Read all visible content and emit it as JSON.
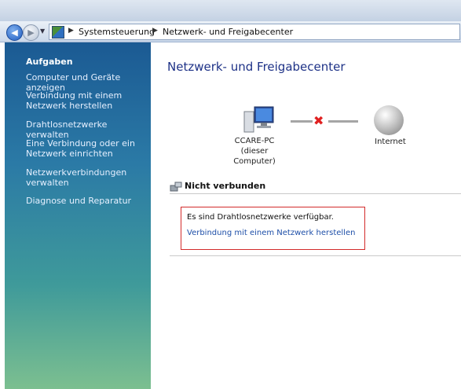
{
  "address_bar": {
    "crumbs": [
      "Systemsteuerung",
      "Netzwerk- und Freigabecenter"
    ]
  },
  "sidebar": {
    "heading": "Aufgaben",
    "items": [
      {
        "label": "Computer und Geräte anzeigen"
      },
      {
        "label": "Verbindung mit einem Netzwerk herstellen"
      },
      {
        "label": "Drahtlosnetzwerke verwalten"
      },
      {
        "label": "Eine Verbindung oder ein Netzwerk einrichten"
      },
      {
        "label": "Netzwerkverbindungen verwalten"
      },
      {
        "label": "Diagnose und Reparatur"
      }
    ]
  },
  "main": {
    "title": "Netzwerk- und Freigabecenter",
    "network_map": {
      "computer_name": "CCARE-PC",
      "computer_note": "(dieser Computer)",
      "internet_label": "Internet",
      "connection_state_icon": "red-x-icon"
    },
    "status": {
      "label": "Nicht verbunden",
      "icon": "network-disconnected-icon"
    },
    "notice": {
      "text": "Es sind Drahtlosnetzwerke verfügbar.",
      "link": "Verbindung mit einem Netzwerk herstellen"
    }
  },
  "colors": {
    "title_blue": "#1e3287",
    "link_blue": "#1e4fa8",
    "notice_border": "#d32b2b",
    "disconnect_x": "#e02020"
  }
}
